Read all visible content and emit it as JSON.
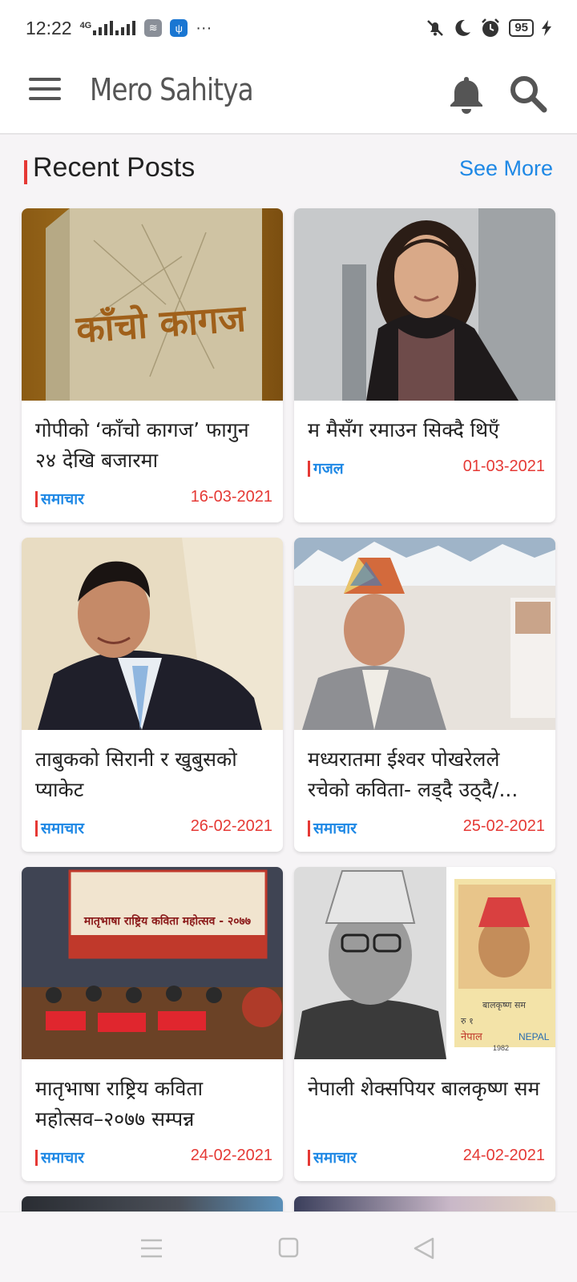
{
  "status_bar": {
    "time": "12:22",
    "network": "4G",
    "battery": "95",
    "more": "···",
    "icons": [
      "signal-icon",
      "stack-app-icon",
      "usb-icon",
      "mute-icon",
      "moon-icon",
      "alarm-icon",
      "charging-icon"
    ]
  },
  "app_bar": {
    "title": "Mero Sahitya",
    "icons": [
      "menu-icon",
      "bell-icon",
      "search-icon"
    ]
  },
  "section": {
    "title": "Recent Posts",
    "see_more": "See More"
  },
  "posts": [
    {
      "title": "गोपीको ‘काँचो कागज’ फागुन २४ देखि बजारमा",
      "category": "समाचार",
      "date": "16-03-2021",
      "image": "book-cover-kancho-kagaj"
    },
    {
      "title": "म मैसँग रमाउन सिक्दै थिएँ",
      "category": "गजल",
      "date": "01-03-2021",
      "image": "woman-portrait"
    },
    {
      "title": "ताबुकको सिरानी र खुबुसको प्याकेट",
      "category": "समाचार",
      "date": "26-02-2021",
      "image": "man-in-suit-portrait"
    },
    {
      "title": "मध्यरातमा ईश्वर पोखरेलले रचेको कविता- लड्दै उठ्दै/...",
      "category": "समाचार",
      "date": "25-02-2021",
      "image": "man-with-topi-office"
    },
    {
      "title": "मातृभाषा राष्ट्रिय कविता महोत्सव–२०७७ सम्पन्न",
      "category": "समाचार",
      "date": "24-02-2021",
      "image": "poetry-festival-stage"
    },
    {
      "title": "नेपाली शेक्सपियर बालकृष्ण सम",
      "category": "समाचार",
      "date": "24-02-2021",
      "image": "balkrishna-sama-stamp"
    }
  ],
  "post_images": {
    "banner_heading": "मातृभाषा राष्ट्रिय कविता महोत्सव - २०७७",
    "book_title": "काँचो कागज",
    "stamp_name": "बालकृष्ण सम",
    "stamp_country": "नेपाल",
    "stamp_country_en": "NEPAL",
    "stamp_year": "1982",
    "stamp_value": "रु १"
  },
  "nav_bar": {
    "icons": [
      "recents-icon",
      "home-icon",
      "back-icon"
    ]
  },
  "colors": {
    "accent_red": "#e53935",
    "link_blue": "#1e88e5",
    "background": "#f6f4f6"
  }
}
